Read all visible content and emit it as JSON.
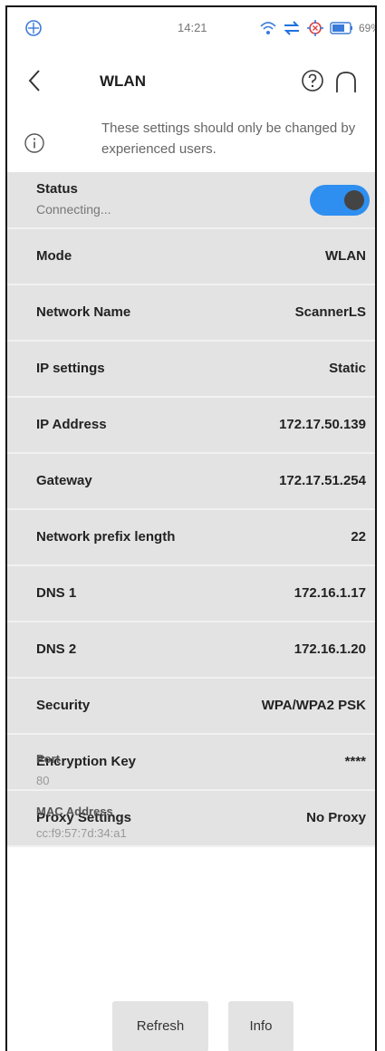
{
  "statusbar": {
    "time": "14:21",
    "battery": "69%",
    "icons": [
      "app-badge-icon",
      "wifi-icon",
      "sync-arrows-icon",
      "location-icon",
      "battery-icon"
    ]
  },
  "header": {
    "title": "WLAN",
    "icons": [
      "back-icon",
      "help-icon",
      "home-icon"
    ]
  },
  "info": {
    "text": "These settings should only be changed by experienced users."
  },
  "status": {
    "label": "Status",
    "sub": "Connecting...",
    "toggle_on": true,
    "accent_color": "#2e8ff0"
  },
  "rows": [
    {
      "label": "Mode",
      "value": "WLAN"
    },
    {
      "label": "Network Name",
      "value": "ScannerLS"
    },
    {
      "label": "IP settings",
      "value": "Static"
    },
    {
      "label": "IP Address",
      "value": "172.17.50.139"
    },
    {
      "label": "Gateway",
      "value": "172.17.51.254"
    },
    {
      "label": "Network prefix length",
      "value": "22"
    },
    {
      "label": "DNS 1",
      "value": "172.16.1.17"
    },
    {
      "label": "DNS 2",
      "value": "172.16.1.20"
    },
    {
      "label": "Security",
      "value": "WPA/WPA2 PSK"
    },
    {
      "label": "Encryption Key",
      "value": "****"
    },
    {
      "label": "Proxy Settings",
      "value": "No Proxy"
    }
  ],
  "port": {
    "label": "Port",
    "value": "80"
  },
  "mac": {
    "label": "MAC Address",
    "value": "cc:f9:57:7d:34:a1"
  },
  "buttons": {
    "refresh": "Refresh",
    "info": "Info"
  }
}
